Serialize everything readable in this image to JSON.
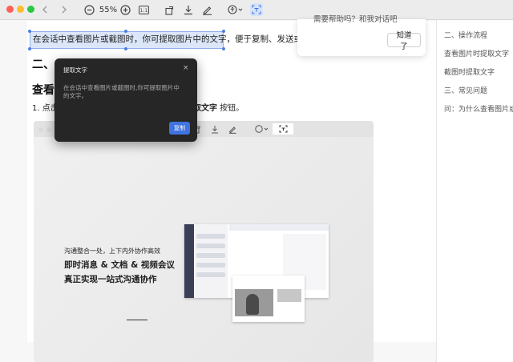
{
  "toolbar": {
    "zoom_label": "55%",
    "icons": [
      "back-icon",
      "forward-icon",
      "zoom-out-icon",
      "zoom-in-icon",
      "actual-size-icon",
      "rotate-icon",
      "download-icon",
      "annotate-icon",
      "accessibility-icon",
      "ocr-icon"
    ]
  },
  "document": {
    "selected_text": "在会话中查看图片或截图时，你可提取图片中的文字，便于复制、发送或保存",
    "heading_2": "二、",
    "heading_3": "查看",
    "step_number": "1.",
    "step_text_left": "点击",
    "step_text_bold": "提取文字",
    "step_text_end": " 按钮。"
  },
  "screenshot": {
    "promo_small": "沟通整合一处，上下内外协作高效",
    "promo_line_1": "即时消息 & 文档 & 视频会议",
    "promo_line_2": "真正实现一站式沟通协作"
  },
  "sidebar": {
    "items": [
      "二、操作流程",
      "查看图片时提取文字",
      "截图时提取文字",
      "三、常见问题",
      "问：为什么查看图片或"
    ]
  },
  "tip": {
    "text": "需要帮助吗？和我对话吧",
    "button_label": "知道了"
  },
  "dialog": {
    "title": "提取文字",
    "close_glyph": "×",
    "body": "在会话中查看图片或截图时,你可提取图片中的文字。",
    "copy_label": "复制"
  },
  "colors": {
    "accent": "#3f73e0",
    "selection": "#dbe6f8",
    "dialog_bg": "#262626"
  }
}
